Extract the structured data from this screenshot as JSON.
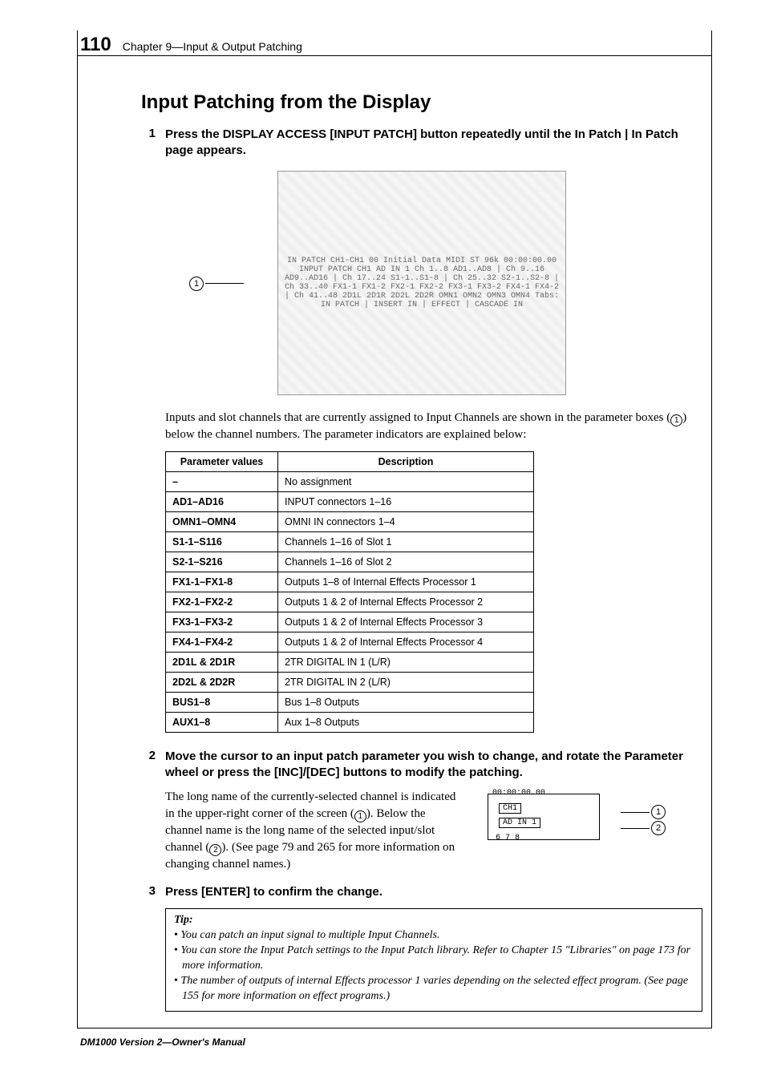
{
  "header": {
    "page_number": "110",
    "chapter_line": "Chapter 9—Input & Output Patching"
  },
  "title": "Input Patching from the Display",
  "steps": {
    "s1": {
      "num": "1",
      "text": "Press the DISPLAY ACCESS [INPUT PATCH] button repeatedly until the In Patch | In Patch page appears."
    },
    "s2": {
      "num": "2",
      "text": "Move the cursor to an input patch parameter you wish to change, and rotate the Parameter wheel or press the [INC]/[DEC] buttons to modify the patching."
    },
    "s3": {
      "num": "3",
      "text": "Press [ENTER] to confirm the change."
    }
  },
  "figure1": {
    "callout": "1",
    "alt": "IN PATCH  CH1-CH1  00  Initial Data  MIDI ST 96k  00:00:00.00\nINPUT PATCH  CH1  AD IN 1\nCh 1..8 AD1..AD8 | Ch 9..16 AD9..AD16 | Ch 17..24 S1-1..S1-8 | Ch 25..32 S2-1..S2-8 | Ch 33..40 FX1-1 FX1-2 FX2-1 FX2-2 FX3-1 FX3-2 FX4-1 FX4-2 | Ch 41..48 2D1L 2D1R 2D2L 2D2R OMN1 OMN2 OMN3 OMN4\nTabs: IN PATCH | INSERT IN | EFFECT | CASCADE IN"
  },
  "intro_para_a": "Inputs and slot channels that are currently assigned to Input Channels are shown in the parameter boxes (",
  "intro_para_b": ") below the channel numbers. The parameter indicators are explained below:",
  "table": {
    "head": {
      "c1": "Parameter values",
      "c2": "Description"
    },
    "rows": [
      {
        "pv": "–",
        "desc": "No assignment"
      },
      {
        "pv": "AD1–AD16",
        "desc": "INPUT connectors 1–16"
      },
      {
        "pv": "OMN1–OMN4",
        "desc": "OMNI IN connectors 1–4"
      },
      {
        "pv": "S1-1–S116",
        "desc": "Channels 1–16 of Slot 1"
      },
      {
        "pv": "S2-1–S216",
        "desc": "Channels 1–16 of Slot 2"
      },
      {
        "pv": "FX1-1–FX1-8",
        "desc": "Outputs 1–8 of Internal Effects Processor 1"
      },
      {
        "pv": "FX2-1–FX2-2",
        "desc": "Outputs 1 & 2 of Internal Effects Processor 2"
      },
      {
        "pv": "FX3-1–FX3-2",
        "desc": "Outputs 1 & 2 of Internal Effects Processor 3"
      },
      {
        "pv": "FX4-1–FX4-2",
        "desc": "Outputs 1 & 2 of Internal Effects Processor 4"
      },
      {
        "pv": "2D1L & 2D1R",
        "desc": "2TR DIGITAL IN 1 (L/R)"
      },
      {
        "pv": "2D2L & 2D2R",
        "desc": "2TR DIGITAL IN 2 (L/R)"
      },
      {
        "pv": "BUS1–8",
        "desc": "Bus 1–8 Outputs"
      },
      {
        "pv": "AUX1–8",
        "desc": "Aux 1–8 Outputs"
      }
    ]
  },
  "step2_detail": {
    "a": "The long name of the currently-selected channel is indicated in the upper-right corner of the screen (",
    "b": "). Below the channel name is the long name of the selected input/slot channel (",
    "c": "). (See page 79 and 265 for more information on changing channel names.)"
  },
  "minifig": {
    "top": "00:00:00.00",
    "ch": "CH1",
    "ad": "AD IN 1",
    "nums": "6        7        8",
    "c1": "1",
    "c2": "2"
  },
  "tip": {
    "label": "Tip:",
    "items": [
      "You can patch an input signal to multiple Input Channels.",
      "You can store the Input Patch settings to the Input Patch library. Refer to Chapter 15 \"Libraries\" on page 173 for more information.",
      "The number of outputs of internal Effects processor 1 varies depending on the selected effect program. (See page 155 for more information on effect programs.)"
    ]
  },
  "footer": "DM1000 Version 2—Owner's Manual",
  "circ": {
    "one": "1",
    "two": "2"
  }
}
